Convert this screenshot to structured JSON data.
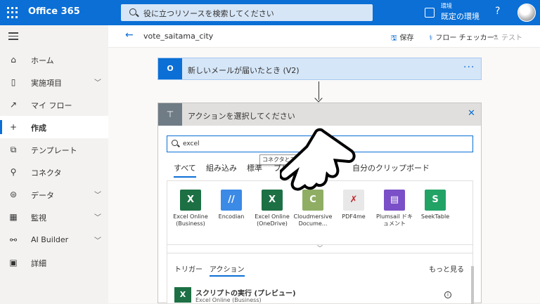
{
  "header": {
    "app_name": "Office 365",
    "search_placeholder": "役に立つリソースを検索してください",
    "env_label": "環境",
    "env_name": "既定の環境",
    "help": "?"
  },
  "sidebar": {
    "items": [
      {
        "label": "ホーム",
        "icon": "home-icon",
        "chevron": false
      },
      {
        "label": "実施項目",
        "icon": "clipboard-icon",
        "chevron": true
      },
      {
        "label": "マイ フロー",
        "icon": "flow-icon",
        "chevron": false
      },
      {
        "label": "作成",
        "icon": "plus-icon",
        "chevron": false,
        "active": true
      },
      {
        "label": "テンプレート",
        "icon": "template-icon",
        "chevron": false
      },
      {
        "label": "コネクタ",
        "icon": "connector-icon",
        "chevron": false
      },
      {
        "label": "データ",
        "icon": "database-icon",
        "chevron": true
      },
      {
        "label": "監視",
        "icon": "monitor-icon",
        "chevron": true
      },
      {
        "label": "AI Builder",
        "icon": "ai-builder-icon",
        "chevron": true
      },
      {
        "label": "詳細",
        "icon": "book-icon",
        "chevron": false
      }
    ]
  },
  "cmdbar": {
    "flow_name": "vote_saitama_city",
    "save": "保存",
    "checker": "フロー チェッカー",
    "test": "テスト"
  },
  "trigger": {
    "title": "新しいメールが届いたとき (V2)",
    "more": "···",
    "icon_letter": "O"
  },
  "panel": {
    "title": "アクションを選択してください",
    "search_value": "excel",
    "tooltip": "コネクタとア",
    "tabs": [
      "すべて",
      "組み込み",
      "標準",
      "プレミア",
      "自分のクリップボード"
    ],
    "connectors": [
      {
        "name": "Excel Online (Business)",
        "color": "#1d7044",
        "letter": "X"
      },
      {
        "name": "Encodian",
        "color": "#3b8ae6",
        "letter": "//"
      },
      {
        "name": "Excel Online (OneDrive)",
        "color": "#1d7044",
        "letter": "X"
      },
      {
        "name": "Cloudmersive Docume...",
        "color": "#8fae64",
        "letter": "C"
      },
      {
        "name": "PDF4me",
        "color": "#e8e8e8",
        "letter": "✗"
      },
      {
        "name": "Plumsail ドキュメント",
        "color": "#7a4fc7",
        "letter": "▤"
      },
      {
        "name": "SeekTable",
        "color": "#21a366",
        "letter": "S"
      }
    ],
    "lower_tabs": [
      "トリガー",
      "アクション"
    ],
    "more_label": "もっと見る",
    "action_title": "スクリプトの実行 (プレビュー)",
    "action_sub": "Excel Online (Business)"
  }
}
